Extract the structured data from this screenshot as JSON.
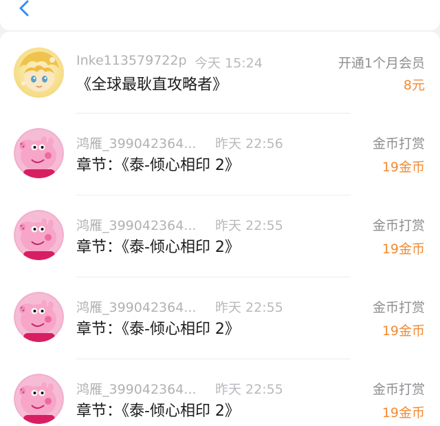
{
  "nav": {
    "back_icon": "chevron-left-icon",
    "accent": "#2f8ff5"
  },
  "records": [
    {
      "avatar": "yellow-anime-avatar",
      "name": "Inke113579722p",
      "time": "今天 15:24",
      "title": "《全球最耿直攻略者》",
      "action": "开通1个月会员",
      "amount": "8元"
    },
    {
      "avatar": "pink-pig-avatar",
      "name": "鸿雁_399042364...",
      "time": "昨天 22:56",
      "title": "章节：《泰-倾心相印 2》",
      "action": "金币打赏",
      "amount": "19金币"
    },
    {
      "avatar": "pink-pig-avatar",
      "name": "鸿雁_399042364...",
      "time": "昨天 22:55",
      "title": "章节：《泰-倾心相印 2》",
      "action": "金币打赏",
      "amount": "19金币"
    },
    {
      "avatar": "pink-pig-avatar",
      "name": "鸿雁_399042364...",
      "time": "昨天 22:55",
      "title": "章节：《泰-倾心相印 2》",
      "action": "金币打赏",
      "amount": "19金币"
    },
    {
      "avatar": "pink-pig-avatar",
      "name": "鸿雁_399042364...",
      "time": "昨天 22:55",
      "title": "章节：《泰-倾心相印 2》",
      "action": "金币打赏",
      "amount": "19金币"
    }
  ],
  "colors": {
    "amount": "#f28a33",
    "name": "#b1b1b6",
    "title": "#1c1c1e"
  }
}
